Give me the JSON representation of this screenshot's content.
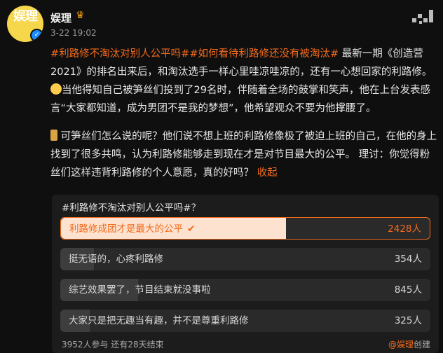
{
  "user": {
    "name": "娱理",
    "avatar_text": "娱理",
    "verified_icon": "verified-badge-icon",
    "crown_icon": "crown-icon",
    "time": "3-22 19:02"
  },
  "post": {
    "tag1": "#利路修不淘汰对别人公平吗#",
    "tag2": "#如何看待利路修还没有被淘汰#",
    "para1_text": " 最新一期《创造营2021》的排名出来后，和淘汰选手一样心里哇凉哇凉的，还有一心想回家的利路修。",
    "para1_text2": "当他得知自己被笋丝们投到了29名时，伴随着全场的鼓掌和笑声，他在上台发表感言“大家都知道，成为男团不是我的梦想”，他希望观众不要为他撑腰了。",
    "para2_text": " 可笋丝们怎么说的呢？他们说不想上班的利路修像极了被迫上班的自己，在他的身上找到了很多共鸣，认为利路修能够走到现在才是对节目最大的公平。 理讨：你觉得粉丝们这样违背利路修的个人意愿，真的好吗？",
    "collapse_label": "收起",
    "accent_color": "#f26b1d"
  },
  "poll": {
    "question": "#利路修不淘汰对别人公平吗#？",
    "options": [
      {
        "label": "利路修成团才是最大的公平",
        "count": "2428人",
        "share": 0.61,
        "selected": true
      },
      {
        "label": "挺无语的，心疼利路修",
        "count": "354人",
        "share": 0.09,
        "selected": false
      },
      {
        "label": "综艺效果罢了，节目结束就没事啦",
        "count": "845人",
        "share": 0.21,
        "selected": false
      },
      {
        "label": "大家只是把无趣当有趣，并不是尊重利路修",
        "count": "325人",
        "share": 0.08,
        "selected": false
      }
    ],
    "footer": "3952人参与  还有28天结束",
    "creator_link": "@娱理",
    "creator_suffix": "创建"
  }
}
